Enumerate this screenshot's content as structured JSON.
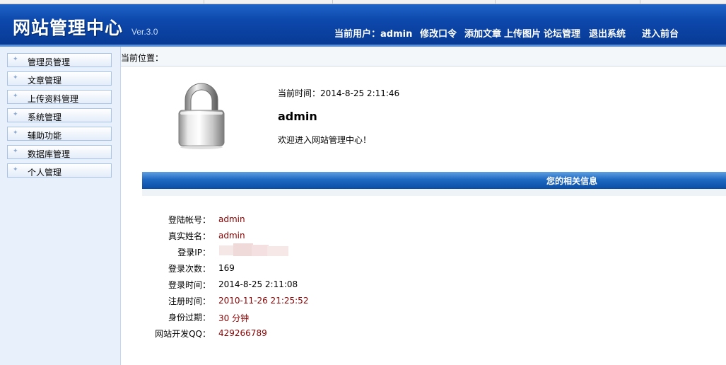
{
  "header": {
    "logo": "网站管理中心",
    "version": "Ver.3.0",
    "current_user_label": "当前用户：",
    "current_user": "admin",
    "nav": [
      "修改口令",
      "添加文章",
      "上传图片",
      "论坛管理",
      "退出系统",
      "进入前台"
    ]
  },
  "sidebar": {
    "items": [
      {
        "label": "管理员管理"
      },
      {
        "label": "文章管理"
      },
      {
        "label": "上传资料管理"
      },
      {
        "label": "系统管理"
      },
      {
        "label": "辅助功能"
      },
      {
        "label": "数据库管理"
      },
      {
        "label": "个人管理"
      }
    ]
  },
  "breadcrumb": "当前位置：",
  "welcome": {
    "time_label": "当前时间：",
    "time": "2014-8-25 2:11:46",
    "username": "admin",
    "message": "欢迎进入网站管理中心！"
  },
  "info": {
    "title": "您的相关信息",
    "rows": [
      {
        "label": "登陆帐号：",
        "value": "admin",
        "color": "#8b0000"
      },
      {
        "label": "真实姓名：",
        "value": "admin",
        "color": "#8b0000"
      },
      {
        "label": "登录IP：",
        "value": "",
        "color": "#000000"
      },
      {
        "label": "登录次数：",
        "value": "169",
        "color": "#000000"
      },
      {
        "label": "登录时间：",
        "value": "2014-8-25 2:11:08",
        "color": "#000000"
      },
      {
        "label": "注册时间：",
        "value": "2010-11-26 21:25:52",
        "color": "#8b0000"
      },
      {
        "label": "身份过期：",
        "value": "30 分钟",
        "color": "#8b0000"
      },
      {
        "label": "网站开发QQ：",
        "value": "429266789",
        "color": "#8b0000"
      }
    ]
  },
  "icons": {
    "lock": "lock-icon",
    "menu_bullet": "bullet-icon"
  }
}
